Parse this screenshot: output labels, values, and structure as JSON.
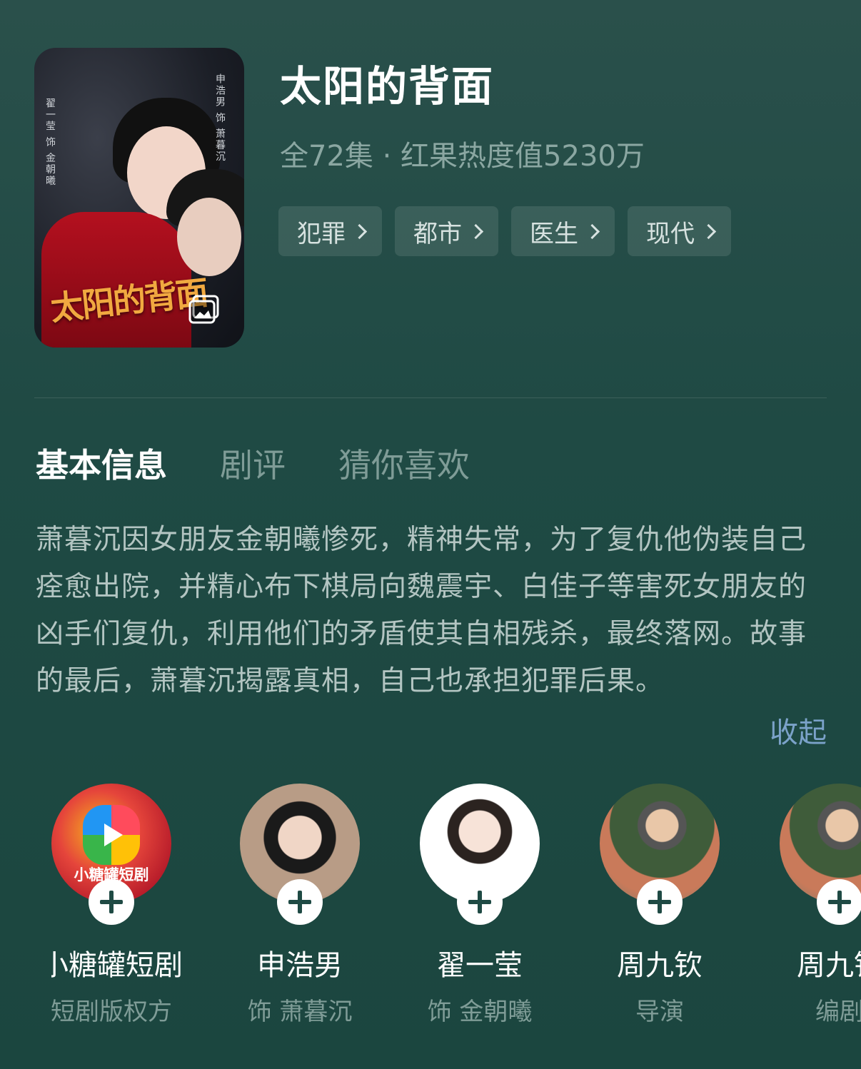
{
  "drama": {
    "title": "太阳的背面",
    "meta": "全72集 · 红果热度值5230万",
    "tags": [
      "犯罪",
      "都市",
      "医生",
      "现代"
    ],
    "poster": {
      "title_art": "太阳的背面",
      "credit_right": "申浩男 饰 萧暮沉",
      "credit_left": "翟一莹 饰 金朝曦"
    }
  },
  "tabs": [
    "基本信息",
    "剧评",
    "猜你喜欢"
  ],
  "active_tab": "基本信息",
  "synopsis": "萧暮沉因女朋友金朝曦惨死，精神失常，为了复仇他伪装自己痊愈出院，并精心布下棋局向魏震宇、白佳子等害死女朋友的凶手们复仇，利用他们的矛盾使其自相残杀，最终落网。故事的最后，萧暮沉揭露真相，自己也承担犯罪后果。",
  "collapse_label": "收起",
  "people": [
    {
      "name": "小糖罐短剧",
      "role": "短剧版权方",
      "avatar_text": "小糖罐短剧"
    },
    {
      "name": "申浩男",
      "role": "饰  萧暮沉"
    },
    {
      "name": "翟一莹",
      "role": "饰  金朝曦"
    },
    {
      "name": "周九钦",
      "role": "导演"
    },
    {
      "name": "周九钦",
      "role": "编剧"
    }
  ],
  "colors": {
    "background": "#1f4a44",
    "accent_link": "#7ba2c9",
    "muted_text": "#7f9c97"
  }
}
